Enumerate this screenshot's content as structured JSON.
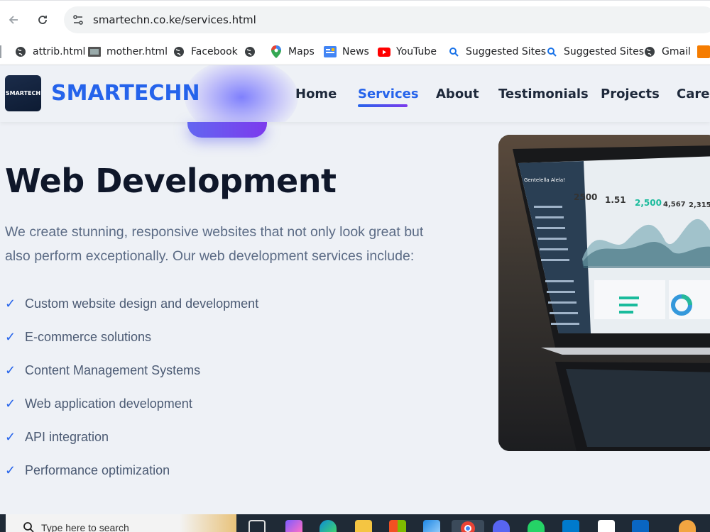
{
  "browser": {
    "url": "smartechn.co.ke/services.html",
    "bookmarks": [
      {
        "label": "attrib.html",
        "icon": "globe-icon"
      },
      {
        "label": "mother.html",
        "icon": "image-icon"
      },
      {
        "label": "Facebook",
        "icon": "globe-icon"
      },
      {
        "label": "",
        "icon": "globe-icon"
      },
      {
        "label": "Maps",
        "icon": "maps-pin-icon"
      },
      {
        "label": "News",
        "icon": "news-icon"
      },
      {
        "label": "YouTube",
        "icon": "youtube-icon"
      },
      {
        "label": "Suggested Sites",
        "icon": "suggested-sites-icon"
      },
      {
        "label": "Suggested Sites",
        "icon": "suggested-sites-icon"
      },
      {
        "label": "Gmail",
        "icon": "globe-icon"
      }
    ]
  },
  "site": {
    "logo_text": "SMARTECH",
    "brand": "SMARTECHN",
    "nav": [
      "Home",
      "Services",
      "About",
      "Testimonials",
      "Projects",
      "Caree"
    ],
    "active_nav": "Services",
    "accent": "#2563eb"
  },
  "main": {
    "title": "Web Development",
    "description": "We create stunning, responsive websites that not only look great but also perform exceptionally. Our web development services include:",
    "features": [
      "Custom website design and development",
      "E-commerce solutions",
      "Content Management Systems",
      "Web application development",
      "API integration",
      "Performance optimization"
    ],
    "check_mark": "✓"
  },
  "dashboard": {
    "app_name": "Gentelella Alela!",
    "stats": [
      "2500",
      "1.51",
      "2,500",
      "4,567",
      "2,315"
    ]
  },
  "taskbar": {
    "search_placeholder": "Type here to search"
  }
}
